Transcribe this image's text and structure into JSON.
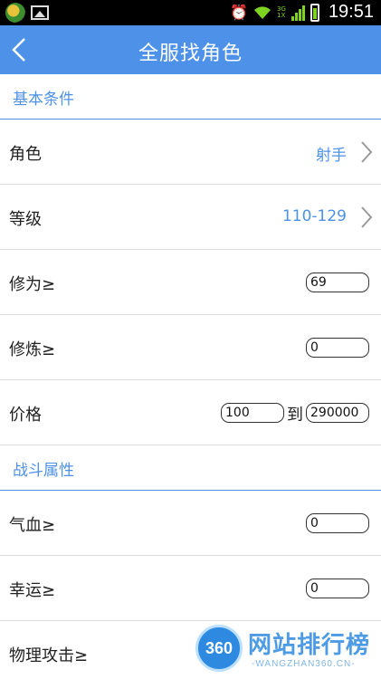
{
  "status_bar": {
    "time": "19:51",
    "network": [
      "3G",
      "1X"
    ]
  },
  "header": {
    "title": "全服找角色"
  },
  "sections": {
    "basic": {
      "title": "基本条件"
    },
    "battle": {
      "title": "战斗属性"
    }
  },
  "rows": {
    "role": {
      "label": "角色",
      "value": "射手"
    },
    "level": {
      "label": "等级",
      "value": "110-129"
    },
    "xiuwei": {
      "label": "修为≥",
      "value": "69"
    },
    "xiulian": {
      "label": "修炼≥",
      "value": "0"
    },
    "price": {
      "label": "价格",
      "min": "100",
      "to": "到",
      "max": "290000"
    },
    "qixue": {
      "label": "气血≥",
      "value": "0"
    },
    "xingyun": {
      "label": "幸运≥",
      "value": "0"
    },
    "wuli": {
      "label": "物理攻击≥"
    }
  },
  "watermark": {
    "badge": "360",
    "text": "网站排行榜",
    "sub": "-WANGZHAN360.CN-"
  },
  "colors": {
    "accent": "#4e91e8",
    "divider": "#dedede"
  }
}
